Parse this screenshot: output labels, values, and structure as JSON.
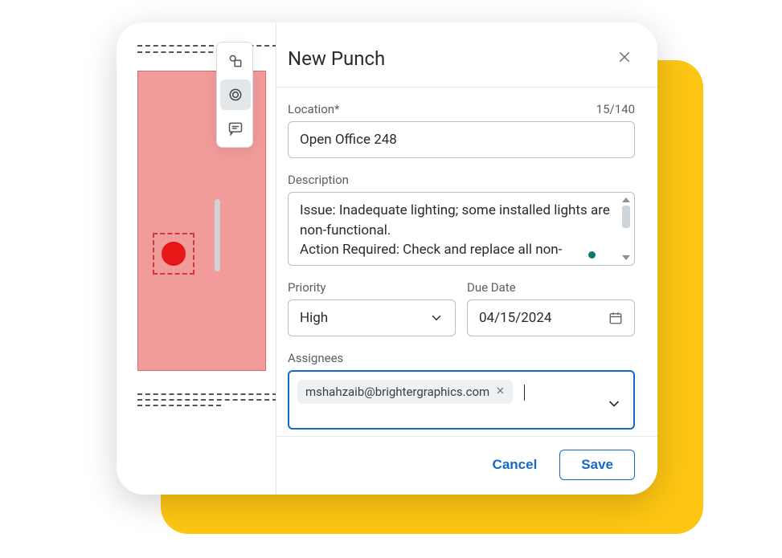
{
  "toolbar": {
    "tools": [
      {
        "name": "shapes-icon"
      },
      {
        "name": "target-icon"
      },
      {
        "name": "comment-icon"
      }
    ],
    "active_index": 1
  },
  "panel": {
    "title": "New Punch"
  },
  "location": {
    "label": "Location*",
    "value": "Open Office 248",
    "counter": "15/140"
  },
  "description": {
    "label": "Description",
    "value": "Issue: Inadequate lighting; some installed lights are non-functional.\nAction Required: Check and replace all non-"
  },
  "priority": {
    "label": "Priority",
    "value": "High"
  },
  "due_date": {
    "label": "Due Date",
    "value": "04/15/2024"
  },
  "assignees": {
    "label": "Assignees",
    "chips": [
      {
        "text": "mshahzaib@brightergraphics.com"
      }
    ]
  },
  "buttons": {
    "cancel": "Cancel",
    "save": "Save"
  },
  "colors": {
    "accent": "#1569c7",
    "marker": "#e61717",
    "yellow": "#fdc613"
  }
}
